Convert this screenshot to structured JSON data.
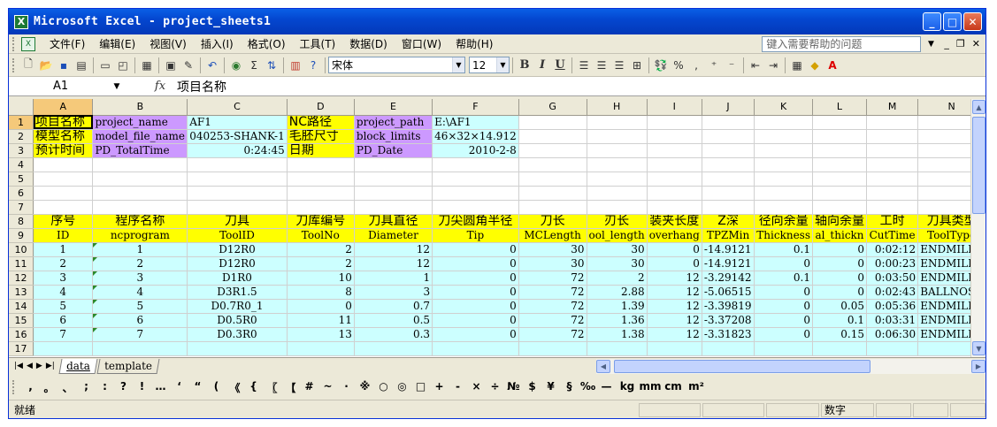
{
  "window": {
    "title": "Microsoft Excel - project_sheets1"
  },
  "menu": {
    "items": [
      "文件(F)",
      "编辑(E)",
      "视图(V)",
      "插入(I)",
      "格式(O)",
      "工具(T)",
      "数据(D)",
      "窗口(W)",
      "帮助(H)"
    ],
    "help_placeholder": "键入需要帮助的问题"
  },
  "toolbar": {
    "font_name": "宋体",
    "font_size": "12"
  },
  "formula": {
    "cell_ref": "A1",
    "content": "项目名称"
  },
  "columns": [
    "A",
    "B",
    "C",
    "D",
    "E",
    "F",
    "G",
    "H",
    "I",
    "J",
    "K",
    "L",
    "M",
    "N"
  ],
  "rows": [
    [
      "项目名称",
      "project_name",
      "AF1",
      "NC路径",
      "project_path",
      "E:\\AF1",
      "",
      "",
      "",
      "",
      "",
      "",
      "",
      ""
    ],
    [
      "模型名称",
      "model_file_name",
      "040253-SHANK-1",
      "毛胚尺寸",
      "block_limits",
      "46×32×14.912",
      "",
      "",
      "",
      "",
      "",
      "",
      "",
      ""
    ],
    [
      "预计时间",
      "PD_TotalTime",
      "0:24:45",
      "日期",
      "PD_Date",
      "2010-2-8",
      "",
      "",
      "",
      "",
      "",
      "",
      "",
      ""
    ],
    [
      "",
      "",
      "",
      "",
      "",
      "",
      "",
      "",
      "",
      "",
      "",
      "",
      "",
      ""
    ],
    [
      "",
      "",
      "",
      "",
      "",
      "",
      "",
      "",
      "",
      "",
      "",
      "",
      "",
      ""
    ],
    [
      "",
      "",
      "",
      "",
      "",
      "",
      "",
      "",
      "",
      "",
      "",
      "",
      "",
      ""
    ],
    [
      "",
      "",
      "",
      "",
      "",
      "",
      "",
      "",
      "",
      "",
      "",
      "",
      "",
      ""
    ],
    [
      "序号",
      "程序名称",
      "刀具",
      "刀库编号",
      "刀具直径",
      "刀尖圆角半径",
      "刀长",
      "刃长",
      "装夹长度",
      "Z深",
      "径向余量",
      "轴向余量",
      "工时",
      "刀具类型"
    ],
    [
      "ID",
      "ncprogram",
      "ToolID",
      "ToolNo",
      "Diameter",
      "Tip",
      "MCLength",
      "ool_length",
      "overhang",
      "TPZMin",
      "Thickness",
      "al_thickn",
      "CutTime",
      "ToolType"
    ],
    [
      "1",
      "1",
      "D12R0",
      "2",
      "12",
      "0",
      "30",
      "30",
      "0",
      "-14.9121",
      "0.1",
      "0",
      "0:02:12",
      "ENDMILL"
    ],
    [
      "2",
      "2",
      "D12R0",
      "2",
      "12",
      "0",
      "30",
      "30",
      "0",
      "-14.9121",
      "0",
      "0",
      "0:00:23",
      "ENDMILL"
    ],
    [
      "3",
      "3",
      "D1R0",
      "10",
      "1",
      "0",
      "72",
      "2",
      "12",
      "-3.29142",
      "0.1",
      "0",
      "0:03:50",
      "ENDMILL"
    ],
    [
      "4",
      "4",
      "D3R1.5",
      "8",
      "3",
      "0",
      "72",
      "2.88",
      "12",
      "-5.06515",
      "0",
      "0",
      "0:02:43",
      "BALLNOSE"
    ],
    [
      "5",
      "5",
      "D0.7R0_1",
      "0",
      "0.7",
      "0",
      "72",
      "1.39",
      "12",
      "-3.39819",
      "0",
      "0.05",
      "0:05:36",
      "ENDMILL"
    ],
    [
      "6",
      "6",
      "D0.5R0",
      "11",
      "0.5",
      "0",
      "72",
      "1.36",
      "12",
      "-3.37208",
      "0",
      "0.1",
      "0:03:31",
      "ENDMILL"
    ],
    [
      "7",
      "7",
      "D0.3R0",
      "13",
      "0.3",
      "0",
      "72",
      "1.38",
      "12",
      "-3.31823",
      "0",
      "0.15",
      "0:06:30",
      "ENDMILL"
    ],
    [
      "",
      "",
      "",
      "",
      "",
      "",
      "",
      "",
      "",
      "",
      "",
      "",
      "",
      ""
    ]
  ],
  "sheets": [
    "data",
    "template"
  ],
  "symbols": [
    ",",
    "。",
    "、",
    ";",
    ":",
    "?",
    "!",
    "…",
    "‘",
    "“",
    "(",
    "《",
    "{",
    "〖",
    "【",
    "#",
    "~",
    "·",
    "※",
    "○",
    "◎",
    "□",
    "+",
    "-",
    "×",
    "÷",
    "№",
    "$",
    "¥",
    "§",
    "‰",
    "—",
    "kg",
    "mm",
    "cm",
    "m²"
  ],
  "status": {
    "left": "就绪",
    "mode": "数字"
  }
}
